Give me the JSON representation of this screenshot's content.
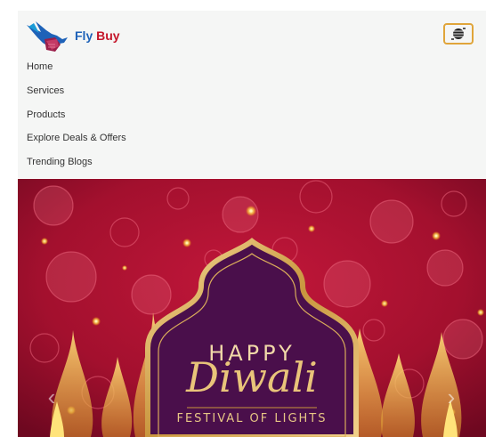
{
  "brand": {
    "fly": "Fly",
    "buy": "Buy",
    "logo_icon": "hummingbird-logo"
  },
  "navbar": {
    "toggler_icon": "hamburger-icon"
  },
  "nav": {
    "items": [
      {
        "label": "Home"
      },
      {
        "label": "Services"
      },
      {
        "label": "Products"
      },
      {
        "label": "Explore Deals & Offers"
      },
      {
        "label": "Trending Blogs"
      }
    ]
  },
  "hero": {
    "happy": "HAPPY",
    "diwali": "Diwali",
    "festival": "FESTIVAL OF LIGHTS",
    "prev_icon": "chevron-left-icon",
    "next_icon": "chevron-right-icon"
  },
  "colors": {
    "accent_border": "#e0a53a",
    "brand_blue": "#1e62b8",
    "brand_red": "#c4162a",
    "hero_red": "#a3102e",
    "hero_purple": "#4a0f4b",
    "gold": "#e9c47a"
  }
}
